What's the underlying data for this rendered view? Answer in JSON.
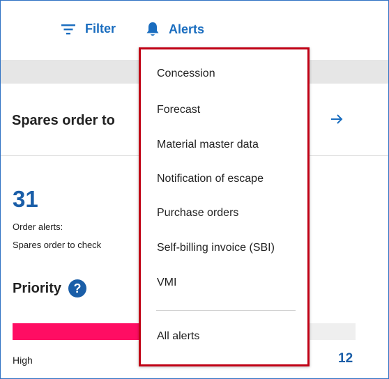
{
  "toolbar": {
    "filter_label": "Filter",
    "filter_icon": "filter-lines-icon",
    "alerts_label": "Alerts",
    "alerts_icon": "bell-icon"
  },
  "card": {
    "title": "Spares order to",
    "arrow_icon": "arrow-right-icon"
  },
  "kpi": {
    "value": "31",
    "label_line1": "Order alerts:",
    "label_line2": "Spares order to check"
  },
  "priority": {
    "title": "Priority",
    "help": "?",
    "bar_label": "High",
    "bar_count": "12",
    "bar_fraction": 0.39
  },
  "colors": {
    "accent": "#1a6dbf",
    "kpi": "#1a5ea8",
    "high_bar": "#ff0d63",
    "highlight_border": "#c00014"
  },
  "menu": {
    "items": [
      "Concession",
      "Forecast",
      "Material master data",
      "Notification of escape",
      "Purchase orders",
      "Self-billing invoice (SBI)",
      "VMI"
    ],
    "footer_item": "All alerts"
  }
}
